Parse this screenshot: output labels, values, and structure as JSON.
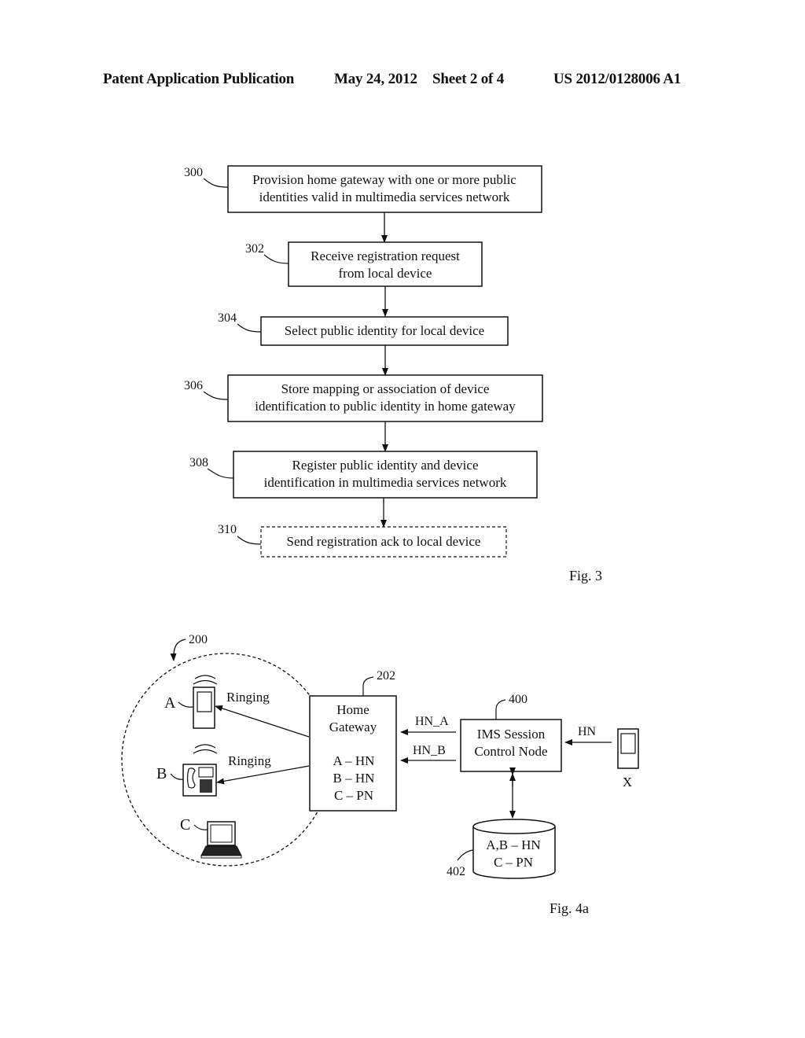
{
  "header": {
    "publication": "Patent Application Publication",
    "date": "May 24, 2012",
    "sheet": "Sheet 2 of 4",
    "number": "US 2012/0128006 A1"
  },
  "fig3": {
    "caption": "Fig. 3",
    "steps": [
      {
        "ref": "300",
        "lines": [
          "Provision home gateway with one or more public",
          "identities valid in multimedia services network"
        ],
        "optional": false
      },
      {
        "ref": "302",
        "lines": [
          "Receive registration request",
          "from local device"
        ],
        "optional": false
      },
      {
        "ref": "304",
        "lines": [
          "Select public identity for local device"
        ],
        "optional": false
      },
      {
        "ref": "306",
        "lines": [
          "Store mapping or association of device",
          "identification to public identity in home gateway"
        ],
        "optional": false
      },
      {
        "ref": "308",
        "lines": [
          "Register public identity and device",
          "identification in multimedia services network"
        ],
        "optional": false
      },
      {
        "ref": "310",
        "lines": [
          "Send registration ack to local device"
        ],
        "optional": true
      }
    ]
  },
  "fig4a": {
    "caption": "Fig. 4a",
    "network_ref": "200",
    "gateway": {
      "ref": "202",
      "title": [
        "Home",
        "Gateway"
      ],
      "mappings": [
        "A – HN",
        "B – HN",
        "C – PN"
      ]
    },
    "ims": {
      "ref": "400",
      "title": [
        "IMS Session",
        "Control Node"
      ]
    },
    "database": {
      "ref": "402",
      "entries": [
        "A,B – HN",
        "C – PN"
      ]
    },
    "devices": {
      "a": "A",
      "b": "B",
      "c": "C",
      "x": "X"
    },
    "labels": {
      "ringing_a": "Ringing",
      "ringing_b": "Ringing",
      "hn_a": "HN_A",
      "hn_b": "HN_B",
      "hn": "HN"
    }
  }
}
